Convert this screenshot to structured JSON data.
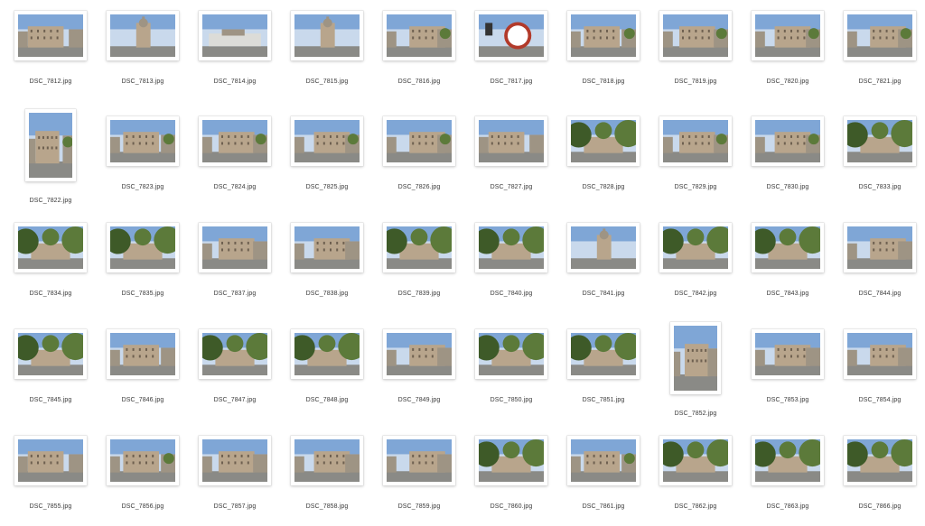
{
  "files": [
    {
      "name": "DSC_7812.jpg",
      "orientation": "landscape",
      "scene": "building"
    },
    {
      "name": "DSC_7813.jpg",
      "orientation": "landscape",
      "scene": "tower"
    },
    {
      "name": "DSC_7814.jpg",
      "orientation": "landscape",
      "scene": "plaza"
    },
    {
      "name": "DSC_7815.jpg",
      "orientation": "landscape",
      "scene": "tower"
    },
    {
      "name": "DSC_7816.jpg",
      "orientation": "landscape",
      "scene": "street"
    },
    {
      "name": "DSC_7817.jpg",
      "orientation": "landscape",
      "scene": "sign"
    },
    {
      "name": "DSC_7818.jpg",
      "orientation": "landscape",
      "scene": "street"
    },
    {
      "name": "DSC_7819.jpg",
      "orientation": "landscape",
      "scene": "street"
    },
    {
      "name": "DSC_7820.jpg",
      "orientation": "landscape",
      "scene": "street"
    },
    {
      "name": "DSC_7821.jpg",
      "orientation": "landscape",
      "scene": "street"
    },
    {
      "name": "DSC_7822.jpg",
      "orientation": "portrait",
      "scene": "street"
    },
    {
      "name": "DSC_7823.jpg",
      "orientation": "landscape",
      "scene": "street"
    },
    {
      "name": "DSC_7824.jpg",
      "orientation": "landscape",
      "scene": "street"
    },
    {
      "name": "DSC_7825.jpg",
      "orientation": "landscape",
      "scene": "street"
    },
    {
      "name": "DSC_7826.jpg",
      "orientation": "landscape",
      "scene": "street"
    },
    {
      "name": "DSC_7827.jpg",
      "orientation": "landscape",
      "scene": "building"
    },
    {
      "name": "DSC_7828.jpg",
      "orientation": "landscape",
      "scene": "trees"
    },
    {
      "name": "DSC_7829.jpg",
      "orientation": "landscape",
      "scene": "street"
    },
    {
      "name": "DSC_7830.jpg",
      "orientation": "landscape",
      "scene": "street"
    },
    {
      "name": "DSC_7833.jpg",
      "orientation": "landscape",
      "scene": "trees"
    },
    {
      "name": "DSC_7834.jpg",
      "orientation": "landscape",
      "scene": "trees"
    },
    {
      "name": "DSC_7835.jpg",
      "orientation": "landscape",
      "scene": "trees"
    },
    {
      "name": "DSC_7837.jpg",
      "orientation": "landscape",
      "scene": "building"
    },
    {
      "name": "DSC_7838.jpg",
      "orientation": "landscape",
      "scene": "building"
    },
    {
      "name": "DSC_7839.jpg",
      "orientation": "landscape",
      "scene": "trees"
    },
    {
      "name": "DSC_7840.jpg",
      "orientation": "landscape",
      "scene": "trees"
    },
    {
      "name": "DSC_7841.jpg",
      "orientation": "landscape",
      "scene": "tower"
    },
    {
      "name": "DSC_7842.jpg",
      "orientation": "landscape",
      "scene": "trees"
    },
    {
      "name": "DSC_7843.jpg",
      "orientation": "landscape",
      "scene": "trees"
    },
    {
      "name": "DSC_7844.jpg",
      "orientation": "landscape",
      "scene": "building"
    },
    {
      "name": "DSC_7845.jpg",
      "orientation": "landscape",
      "scene": "trees"
    },
    {
      "name": "DSC_7846.jpg",
      "orientation": "landscape",
      "scene": "building"
    },
    {
      "name": "DSC_7847.jpg",
      "orientation": "landscape",
      "scene": "trees"
    },
    {
      "name": "DSC_7848.jpg",
      "orientation": "landscape",
      "scene": "trees"
    },
    {
      "name": "DSC_7849.jpg",
      "orientation": "landscape",
      "scene": "building"
    },
    {
      "name": "DSC_7850.jpg",
      "orientation": "landscape",
      "scene": "trees"
    },
    {
      "name": "DSC_7851.jpg",
      "orientation": "landscape",
      "scene": "trees"
    },
    {
      "name": "DSC_7852.jpg",
      "orientation": "portrait",
      "scene": "building"
    },
    {
      "name": "DSC_7853.jpg",
      "orientation": "landscape",
      "scene": "building"
    },
    {
      "name": "DSC_7854.jpg",
      "orientation": "landscape",
      "scene": "building"
    },
    {
      "name": "DSC_7855.jpg",
      "orientation": "landscape",
      "scene": "building"
    },
    {
      "name": "DSC_7856.jpg",
      "orientation": "landscape",
      "scene": "street"
    },
    {
      "name": "DSC_7857.jpg",
      "orientation": "landscape",
      "scene": "building"
    },
    {
      "name": "DSC_7858.jpg",
      "orientation": "landscape",
      "scene": "building"
    },
    {
      "name": "DSC_7859.jpg",
      "orientation": "landscape",
      "scene": "building"
    },
    {
      "name": "DSC_7860.jpg",
      "orientation": "landscape",
      "scene": "trees"
    },
    {
      "name": "DSC_7861.jpg",
      "orientation": "landscape",
      "scene": "street"
    },
    {
      "name": "DSC_7862.jpg",
      "orientation": "landscape",
      "scene": "trees"
    },
    {
      "name": "DSC_7863.jpg",
      "orientation": "landscape",
      "scene": "trees"
    },
    {
      "name": "DSC_7866.jpg",
      "orientation": "landscape",
      "scene": "trees"
    }
  ],
  "colors": {
    "label": "#3a3a3a",
    "sky": "#7fa6d6",
    "sky_light": "#c9d9ec",
    "building": "#b8a58c",
    "stone": "#9e9484",
    "street": "#8a8a86",
    "tree": "#5c7a3a",
    "tree_dark": "#3e5a28",
    "accent_red": "#b23a2a"
  }
}
